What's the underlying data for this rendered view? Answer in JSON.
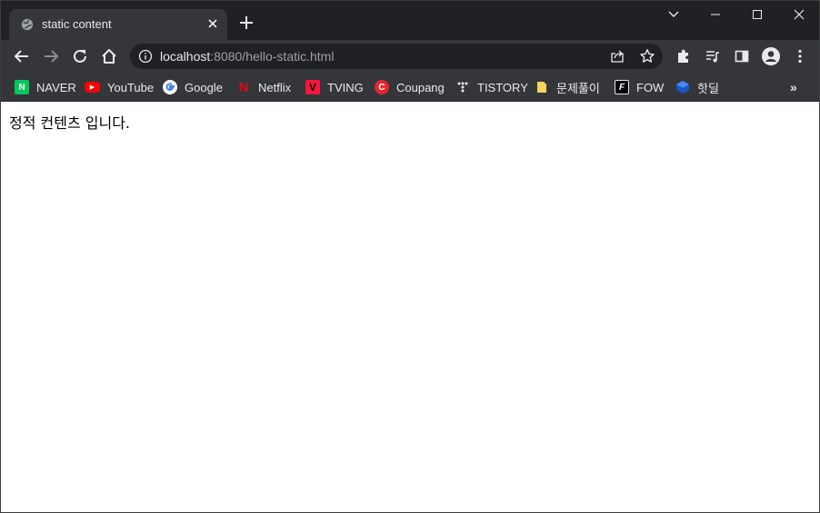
{
  "tab": {
    "title": "static content",
    "favicon": "globe-icon"
  },
  "toolbar": {
    "url_host": "localhost",
    "url_path": ":8080/hello-static.html"
  },
  "bookmarks": [
    {
      "label": "NAVER",
      "icon": "naver-icon",
      "color": "#03c75a",
      "glyph": "N"
    },
    {
      "label": "YouTube",
      "icon": "youtube-icon",
      "color": "#ff0000",
      "glyph": "▶"
    },
    {
      "label": "Google",
      "icon": "google-icon",
      "color": "#4285f4",
      "glyph": "G"
    },
    {
      "label": "Netflix",
      "icon": "netflix-icon",
      "color": "#e50914",
      "glyph": "N"
    },
    {
      "label": "TVING",
      "icon": "tving-icon",
      "color": "#ff153c",
      "glyph": "V"
    },
    {
      "label": "Coupang",
      "icon": "coupang-icon",
      "color": "#e5262c",
      "glyph": "C"
    },
    {
      "label": "TISTORY",
      "icon": "tistory-icon",
      "color": "#000000",
      "glyph": "⁘"
    },
    {
      "label": "문제풀이",
      "icon": "folder-icon",
      "color": "#f6d55c",
      "glyph": ""
    },
    {
      "label": "FOW",
      "icon": "fow-icon",
      "color": "#000000",
      "glyph": "F"
    },
    {
      "label": "핫딜",
      "icon": "hotdeal-icon",
      "color": "#1a56c6",
      "glyph": "◆"
    }
  ],
  "bookmarks_more": "»",
  "content": {
    "text": "정적 컨텐츠 입니다."
  }
}
